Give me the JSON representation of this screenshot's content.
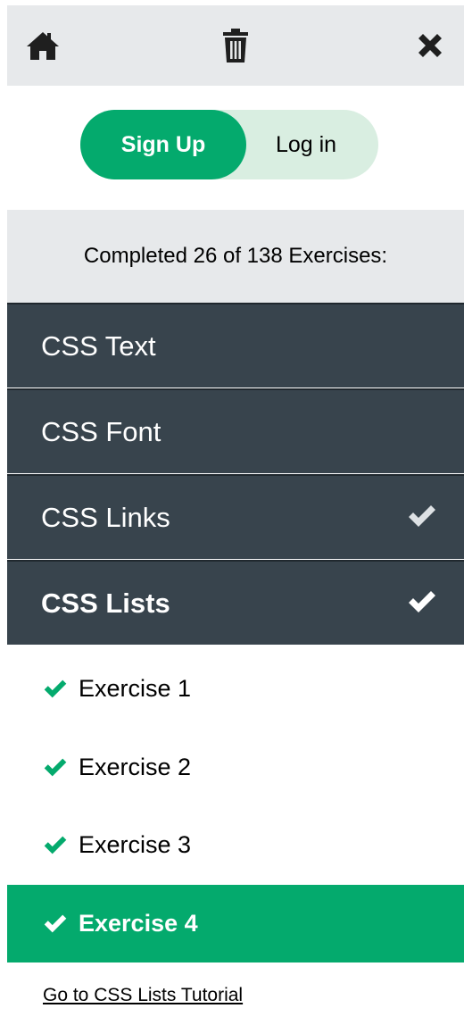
{
  "topbar": {
    "icons": {
      "home": "home-icon",
      "trash": "trash-icon",
      "close": "close-icon"
    }
  },
  "auth_toggle": {
    "signup_label": "Sign Up",
    "login_label": "Log in"
  },
  "progress": {
    "text": "Completed 26 of 138 Exercises:"
  },
  "sections": [
    {
      "label": "CSS Text",
      "completed": false,
      "active": false
    },
    {
      "label": "CSS Font",
      "completed": false,
      "active": false
    },
    {
      "label": "CSS Links",
      "completed": true,
      "active": false
    },
    {
      "label": "CSS Lists",
      "completed": true,
      "active": true
    }
  ],
  "exercises": [
    {
      "label": "Exercise 1",
      "completed": true,
      "active": false
    },
    {
      "label": "Exercise 2",
      "completed": true,
      "active": false
    },
    {
      "label": "Exercise 3",
      "completed": true,
      "active": false
    },
    {
      "label": "Exercise 4",
      "completed": true,
      "active": true
    }
  ],
  "tutorial_link": "Go to CSS Lists Tutorial",
  "colors": {
    "accent": "#04aa6d",
    "section_bg": "#38444d",
    "bar_bg": "#e7e9eb",
    "toggle_bg": "#d9eee1"
  }
}
